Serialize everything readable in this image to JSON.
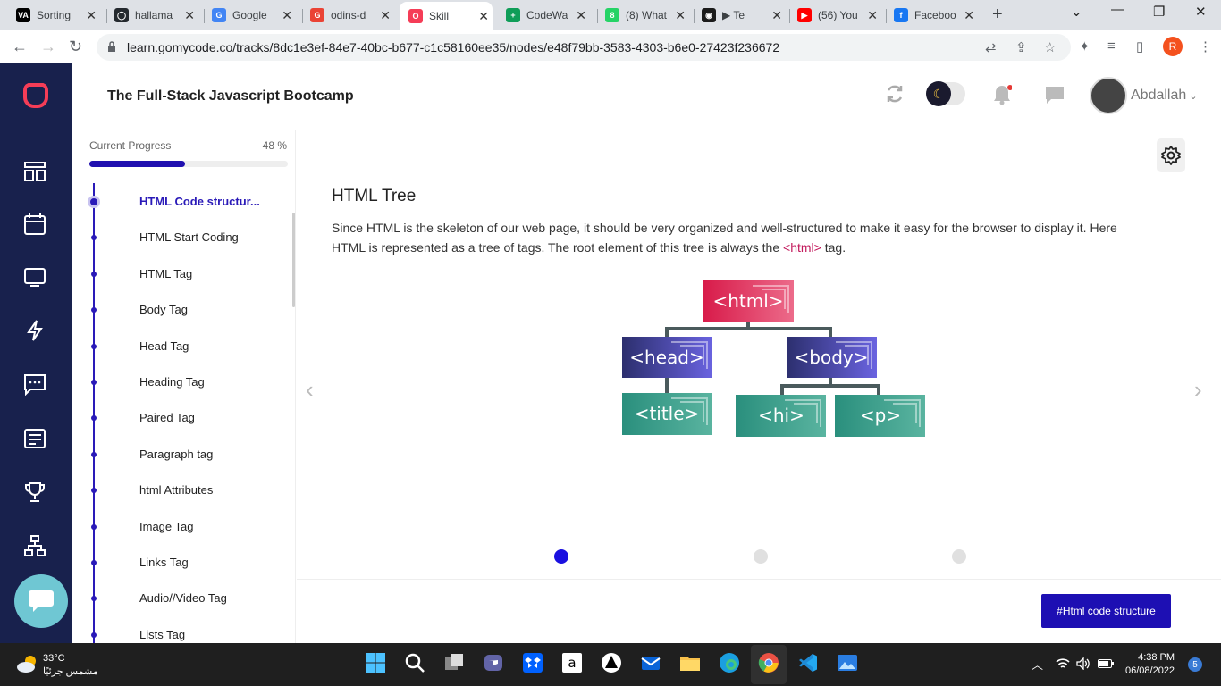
{
  "browser": {
    "tabs": [
      {
        "title": "Sorting",
        "icon": "va-icon",
        "color": "#000000",
        "glyph": "VA"
      },
      {
        "title": "hallama",
        "icon": "github-icon",
        "color": "#24292e",
        "glyph": "◯"
      },
      {
        "title": "Google",
        "icon": "google-translate-icon",
        "color": "#4285f4",
        "glyph": "G"
      },
      {
        "title": "odins-d",
        "icon": "odin-icon",
        "color": "#ea4335",
        "glyph": "G"
      },
      {
        "title": "Skill",
        "icon": "gomycode-icon",
        "color": "#f53d57",
        "glyph": "O"
      },
      {
        "title": "CodeWa",
        "icon": "codewars-sheets-icon",
        "color": "#0f9d58",
        "glyph": "+"
      },
      {
        "title": "(8) What",
        "icon": "whatsapp-icon",
        "color": "#25d366",
        "glyph": "8"
      },
      {
        "title": "▶ Te",
        "icon": "audio-tab-icon",
        "color": "#1b1b1b",
        "glyph": "◉"
      },
      {
        "title": "(56) You",
        "icon": "youtube-icon",
        "color": "#ff0000",
        "glyph": "▶"
      },
      {
        "title": "Faceboo",
        "icon": "facebook-icon",
        "color": "#1877f2",
        "glyph": "f"
      }
    ],
    "url": "learn.gomycode.co/tracks/8dc1e3ef-84e7-40bc-b677-c1c58160ee35/nodes/e48f79bb-3583-4303-b6e0-27423f236672",
    "profile_letter": "R"
  },
  "header": {
    "title": "The Full-Stack Javascript Bootcamp",
    "username": "Abdallah"
  },
  "progress": {
    "label": "Current Progress",
    "value_text": "48 %",
    "value": 0.48
  },
  "lessons": [
    {
      "label": "HTML Code structur...",
      "active": true
    },
    {
      "label": "HTML Start Coding"
    },
    {
      "label": "HTML Tag"
    },
    {
      "label": "Body Tag"
    },
    {
      "label": "Head Tag"
    },
    {
      "label": "Heading Tag"
    },
    {
      "label": "Paired Tag"
    },
    {
      "label": "Paragraph tag"
    },
    {
      "label": "html Attributes"
    },
    {
      "label": "Image Tag"
    },
    {
      "label": "Links Tag"
    },
    {
      "label": "Audio//Video Tag"
    },
    {
      "label": "Lists Tag"
    }
  ],
  "content": {
    "title": "HTML Tree",
    "text_before": "Since HTML is the skeleton of our web page, it should be very organized and well-structured to make it easy for the browser to display it. Here HTML is represented as a tree of tags. The root element of this tree is always the ",
    "tag": "<html>",
    "text_after": " tag.",
    "tree": {
      "root": "<html>",
      "head": "<head>",
      "body": "<body>",
      "title": "<title>",
      "h1": "<hi>",
      "p": "<p>"
    },
    "action_button": "#Html code structure"
  },
  "colors": {
    "accent": "#1d0fb3",
    "sidebar": "#18214d",
    "brand": "#f53d57"
  },
  "taskbar": {
    "temperature": "33°C",
    "weather_text": "مشمس جزئيًا",
    "time": "4:38 PM",
    "date": "06/08/2022",
    "notifications": "5"
  }
}
